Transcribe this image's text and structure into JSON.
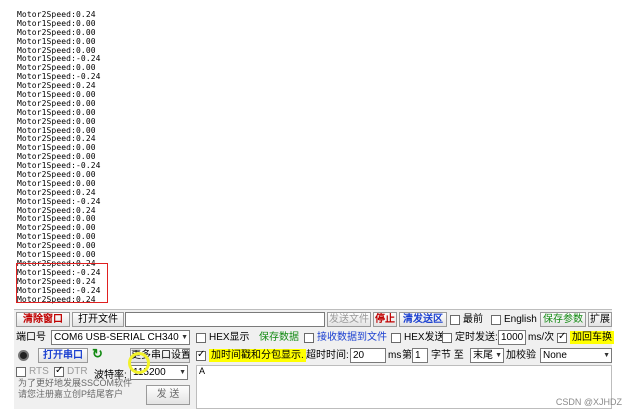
{
  "log_lines": [
    "Motor2Speed:0.24",
    "Motor1Speed:0.00",
    "Motor2Speed:0.00",
    "Motor1Speed:0.00",
    "Motor2Speed:0.00",
    "Motor1Speed:-0.24",
    "Motor2Speed:0.00",
    "Motor1Speed:-0.24",
    "Motor2Speed:0.24",
    "Motor1Speed:0.00",
    "Motor2Speed:0.00",
    "Motor1Speed:0.00",
    "Motor2Speed:0.00",
    "Motor1Speed:0.00",
    "Motor2Speed:0.24",
    "Motor1Speed:0.00",
    "Motor2Speed:0.00",
    "Motor1Speed:-0.24",
    "Motor2Speed:0.00",
    "Motor1Speed:0.00",
    "Motor2Speed:0.24",
    "Motor1Speed:-0.24",
    "Motor2Speed:0.24",
    "Motor1Speed:0.00",
    "Motor2Speed:0.00",
    "Motor1Speed:0.00",
    "Motor2Speed:0.00",
    "Motor1Speed:0.00",
    "Motor2Speed:0.24",
    "Motor1Speed:-0.24",
    "Motor2Speed:0.24",
    "Motor1Speed:-0.24",
    "Motor2Speed:0.24"
  ],
  "toolbar1": {
    "clear_window": "清除窗口",
    "open_file": "打开文件",
    "send_file": "发送文件",
    "stop": "停止",
    "clear_send": "清发送区",
    "topmost": "最前",
    "english": "English",
    "save_params": "保存参数",
    "expand": "扩展"
  },
  "toolbar2": {
    "port_label": "端口号",
    "port_value": "COM6 USB-SERIAL CH340",
    "hex_display": "HEX显示",
    "save_data": "保存数据",
    "recv_to_file": "接收数据到文件",
    "hex_send": "HEX发送",
    "timed_send": "定时发送:",
    "interval": "1000",
    "interval_unit": "ms/次",
    "add_crlf": "加回车换"
  },
  "toolbar3": {
    "open_port": "打开串口",
    "more_settings": "更多串口设置",
    "timestamp": "加时间戳和分包显示.",
    "timeout_label": "超时时间:",
    "timeout_value": "20",
    "timeout_unit": "ms",
    "frame_label": "第",
    "frame_value": "1",
    "byte_label": "字节 至",
    "tail_value": "末尾",
    "checksum_label": "加校验",
    "checksum_value": "None"
  },
  "toolbar4": {
    "rts": "RTS",
    "dtr": "DTR",
    "baud_label": "波特率:",
    "baud_value": "115200",
    "send_text": "A",
    "send_button": "发 送",
    "hint": "为了更好地发展SSCOM软件\n请您注册嘉立创P结尾客户"
  },
  "watermark": "CSDN @XJHDZ"
}
